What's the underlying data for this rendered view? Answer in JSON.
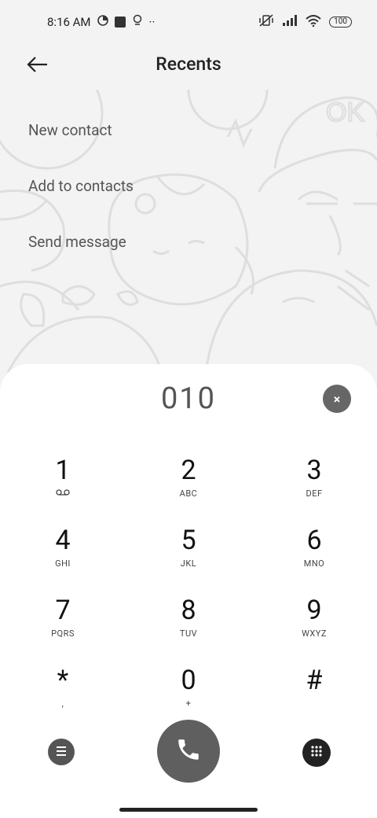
{
  "status_bar": {
    "time": "8:16 AM",
    "dots": "··",
    "battery": "100"
  },
  "header": {
    "title": "Recents"
  },
  "menu": {
    "items": [
      "New contact",
      "Add to contacts",
      "Send message"
    ]
  },
  "dialer": {
    "number": "010",
    "clear_label": "×",
    "keys": [
      [
        {
          "digit": "1",
          "letters": ""
        },
        {
          "digit": "2",
          "letters": "ABC"
        },
        {
          "digit": "3",
          "letters": "DEF"
        }
      ],
      [
        {
          "digit": "4",
          "letters": "GHI"
        },
        {
          "digit": "5",
          "letters": "JKL"
        },
        {
          "digit": "6",
          "letters": "MNO"
        }
      ],
      [
        {
          "digit": "7",
          "letters": "PQRS"
        },
        {
          "digit": "8",
          "letters": "TUV"
        },
        {
          "digit": "9",
          "letters": "WXYZ"
        }
      ],
      [
        {
          "digit": "*",
          "letters": ","
        },
        {
          "digit": "0",
          "letters": "+"
        },
        {
          "digit": "#",
          "letters": ""
        }
      ]
    ]
  },
  "background_text": "OK",
  "icons": {
    "back": "arrow-left-icon",
    "voicemail": "voicemail-icon",
    "clear": "close-icon",
    "menu": "menu-icon",
    "call": "phone-icon",
    "dialpad": "dialpad-icon"
  },
  "colors": {
    "call_button": "#5f5f5f",
    "sheet": "#ffffff",
    "background": "#f3f3f3"
  }
}
